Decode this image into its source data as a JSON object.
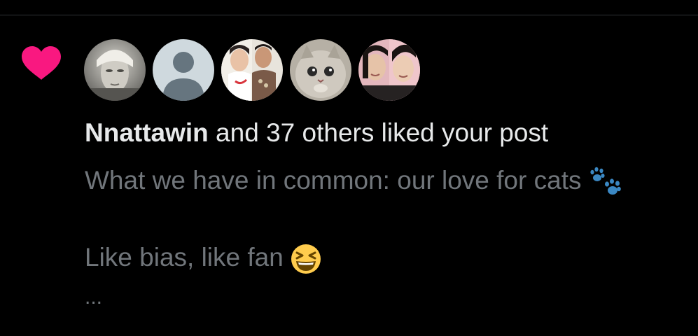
{
  "notification": {
    "type_icon": "heart-icon",
    "accent_color": "#f91880",
    "avatars": [
      {
        "name": "avatar-1"
      },
      {
        "name": "avatar-2-default"
      },
      {
        "name": "avatar-3"
      },
      {
        "name": "avatar-4-cat"
      },
      {
        "name": "avatar-5"
      }
    ],
    "user_name": "Nnattawin",
    "rest_text": " and 37 others liked your post",
    "post_line_1": "What we have in common: our love for cats ",
    "post_line_1_emoji": "paw-prints-icon",
    "post_line_2": "Like bias, like fan ",
    "post_line_2_emoji": "laughing-face-icon",
    "ellipsis": "..."
  }
}
